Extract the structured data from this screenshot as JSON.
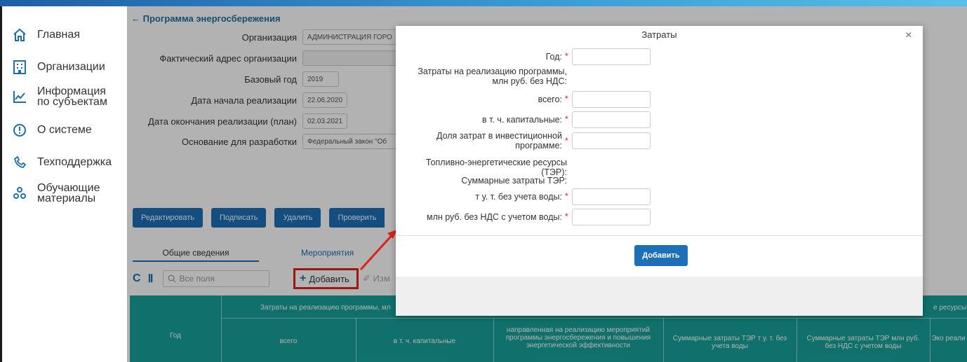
{
  "sidebar": {
    "items": [
      {
        "label": "Главная",
        "icon": "home-icon"
      },
      {
        "label": "Организации",
        "icon": "building-icon"
      },
      {
        "label_line1": "Информация",
        "label_line2": "по субъектам",
        "icon": "chart-icon"
      },
      {
        "label": "О системе",
        "icon": "info-icon"
      },
      {
        "label": "Техподдержка",
        "icon": "support-icon"
      },
      {
        "label_line1": "Обучающие",
        "label_line2": "материалы",
        "icon": "learning-icon"
      }
    ]
  },
  "page": {
    "back_label": "← Программа энергосбережения",
    "fields": [
      {
        "label": "Организация",
        "value": "АДМИНИСТРАЦИЯ ГОРО"
      },
      {
        "label": "Фактический адрес организации",
        "value": ""
      },
      {
        "label": "Базовый год",
        "value": "2019"
      },
      {
        "label": "Дата начала реализации",
        "value": "22.06.2020"
      },
      {
        "label": "Дата окончания реализации (план)",
        "value": "02.03.2021"
      },
      {
        "label": "Основание для разработки",
        "value": "Федеральный закон \"Об"
      }
    ],
    "buttons": [
      "Редактировать",
      "Подписать",
      "Удалить",
      "Проверить"
    ],
    "tabs": [
      "Общие сведения",
      "Мероприятия"
    ],
    "toolbar": {
      "search_placeholder": "Все поля",
      "add_label": "Добавить",
      "edit_label": "Изм"
    },
    "grid": {
      "top_header": "Затраты на реализацию программы, мл",
      "top_header_right": "е ресурсы",
      "columns": [
        "Год",
        "всего",
        "в т. ч. капитальные",
        "направленная на реализацию мероприятий программы энергосбережения и повышения энергетической эффективности",
        "Суммарные затраты ТЭР т у. т. без учета воды",
        "Суммарные затраты ТЭР млн руб. без НДС с учетом воды",
        "Эко реали"
      ]
    }
  },
  "modal": {
    "title": "Затраты",
    "close": "×",
    "fields": [
      {
        "label": "Год:",
        "required": true
      },
      {
        "label_line1": "Затраты на реализацию программы,",
        "label_line2": "млн руб. без НДС:",
        "required": false
      },
      {
        "label": "всего:",
        "required": true
      },
      {
        "label": "в т. ч. капитальные:",
        "required": true
      },
      {
        "label_line1": "Доля затрат в инвестиционной",
        "label_line2": "программе:",
        "required": true
      },
      {
        "label_line1": "Топливно-энергетические ресурсы",
        "label_line2": "(ТЭР):",
        "required": false
      },
      {
        "label": "Суммарные затраты ТЭР:",
        "required": false
      },
      {
        "label": "т у. т. без учета воды:",
        "required": true
      },
      {
        "label": "млн руб. без НДС с учетом воды:",
        "required": true
      }
    ],
    "required_mark": "*",
    "submit_label": "Добавить"
  },
  "colors": {
    "accent": "#1d6fb8",
    "grid_header": "#17a39b",
    "highlight": "#e0201a"
  }
}
